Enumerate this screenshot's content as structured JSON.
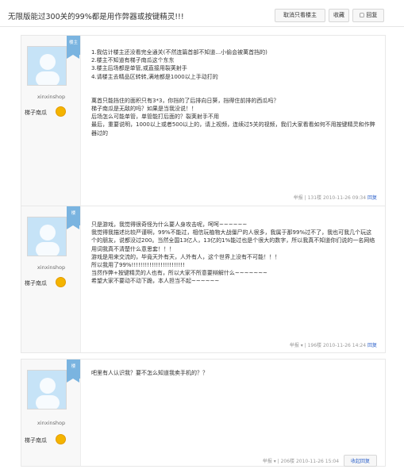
{
  "header": {
    "title": "无限版能过300关的99%都是用作弊器或按键精灵!!!",
    "btn_mod": "取消只看楼主",
    "btn_fav": "收藏",
    "btn_reply": "回复"
  },
  "posts": [
    {
      "badge": "楼主",
      "username": "xinxinshop",
      "rank": "梯子南瓜",
      "paragraphs": [
        "1.我估计楼主还没看完全通关(不然连篇首部不知道...小偷会被萬首挡的)",
        "2.楼主不知道有梯子南瓜这个东东",
        "3.楼主后场都是单管,或直接用裂荚射手",
        "4.请楼主去精品区转转,满地都是1000以上手动打的",
        "",
        "萬首只能挡住的面积只有3*3，你挡的了后排向日葵，挡得住前排的西瓜吗？",
        "梯子南瓜是无敌的吗？如果是当我没说！！",
        "后场怎么可能单管，单管能打后面的？裂荚射手不用",
        "最后，重要说明，1000以上或者500以上的，请上视频，连续过5关的视频，我们大家看看如何不用按键精灵和作弊器过的"
      ],
      "footer": {
        "report": "举报",
        "floor": "131楼",
        "date": "2010-11-26 09:34",
        "reply": "回复"
      }
    },
    {
      "badge": "楼",
      "username": "xinxinshop",
      "rank": "梯子南瓜",
      "paragraphs": [
        "只是游戏，我觉得很奇怪为什么要人身攻击呢，呵呵~~~~~~",
        "我觉得我描述比较严谨啊，99%不能过，相信玩植物大战僵尸的人很多，我属于那99%过不了，我也可我几个玩这个的朋友，说都没过200。当然全国13亿人，13亿的1%能过也是个很大的数字，所以我真不知道你们说的一名网络用词我真不清楚什么意思套！！！",
        "游戏是用来交流的，毕竟天外有天，人外有人，这个世界上没有不可能！！！",
        "所以我用了99%!!!!!!!!!!!!!!!!!!!!!!!!",
        "当然作弊+按键精灵的人也有，所以大家不所意要辩解什么~~~~~~~",
        "希望大家不要动不动下跪，本人担当不起~~~~~~"
      ],
      "footer": {
        "report": "举报",
        "floor": "196楼",
        "date": "2010-11-26 14:24",
        "reply": "回复"
      }
    },
    {
      "badge": "楼",
      "username": "xinxinshop",
      "rank": "梯子南瓜",
      "paragraphs": [
        "吧里有人认识我？要不怎么知道我卖手机的？？"
      ],
      "footer": {
        "report": "举报",
        "floor": "206楼",
        "date": "2010-11-26 15:04",
        "reply": "收起回复"
      }
    }
  ]
}
